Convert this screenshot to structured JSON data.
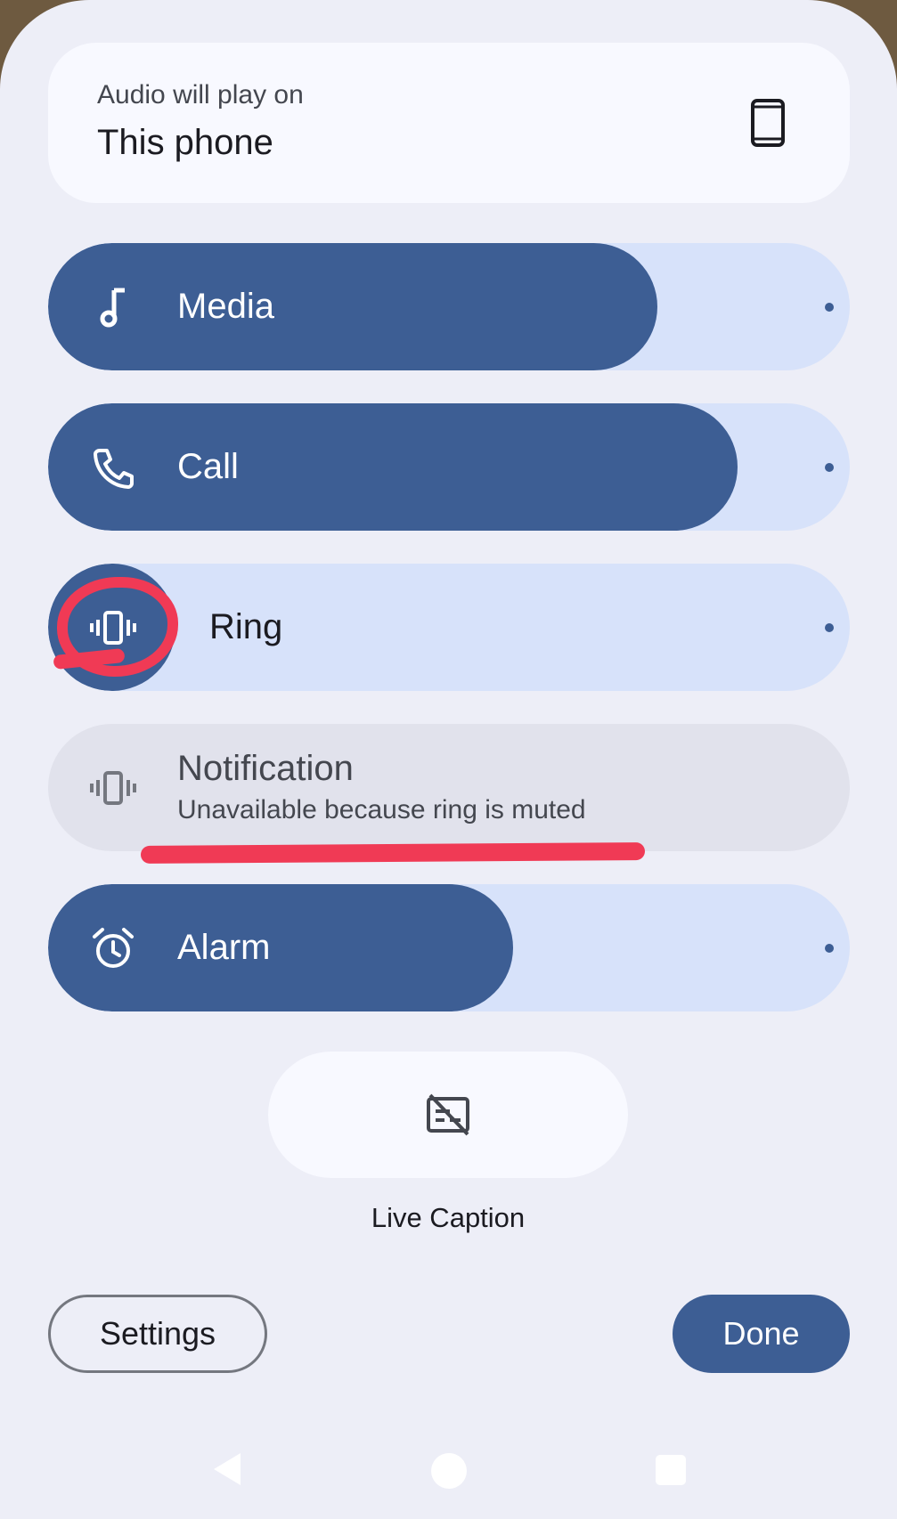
{
  "output": {
    "label": "Audio will play on",
    "device": "This phone",
    "icon": "smartphone-icon"
  },
  "sliders": [
    {
      "label": "Media",
      "icon": "music-note-icon",
      "level": 0.76
    },
    {
      "label": "Call",
      "icon": "phone-icon",
      "level": 0.86
    },
    {
      "label": "Ring",
      "icon": "vibrate-icon",
      "level": 0.0
    },
    {
      "label": "Notification",
      "sublabel": "Unavailable because ring is muted",
      "icon": "vibrate-icon",
      "enabled": false
    },
    {
      "label": "Alarm",
      "icon": "alarm-clock-icon",
      "level": 0.58
    }
  ],
  "live_caption": {
    "label": "Live Caption",
    "icon": "closed-caption-off-icon"
  },
  "footer": {
    "settings_label": "Settings",
    "done_label": "Done"
  },
  "nav": {
    "back": "back-icon",
    "home": "home-icon",
    "recents": "recents-icon"
  },
  "colors": {
    "accent": "#3d5e94",
    "track": "#d7e2fa",
    "annotation": "#f03a55"
  }
}
